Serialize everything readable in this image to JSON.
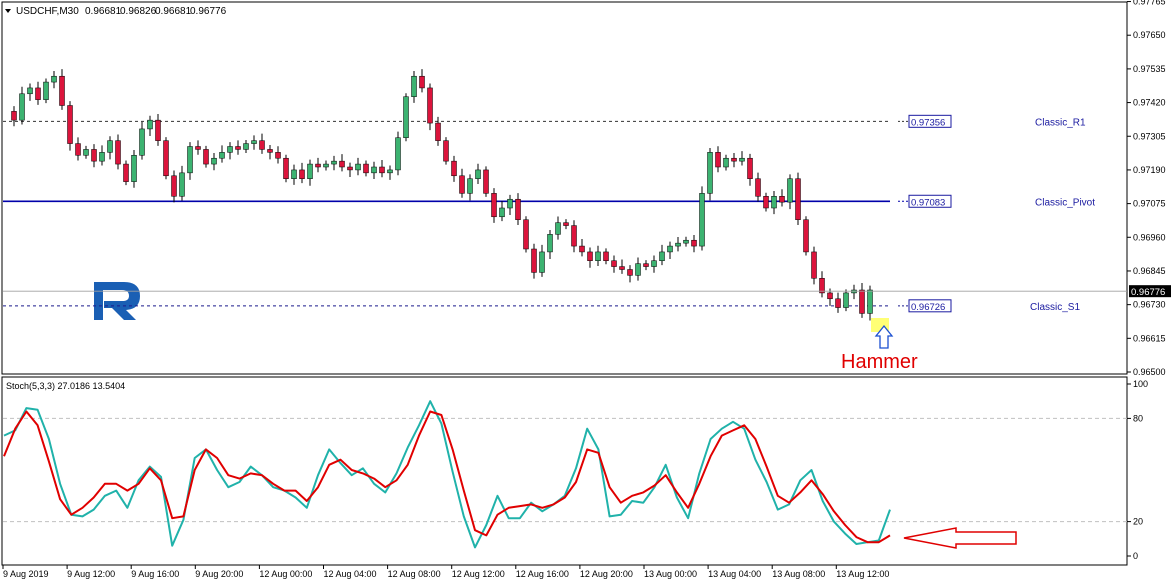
{
  "chart_data": [
    {
      "type": "candlestick",
      "symbol_header": "USDCHF,M30",
      "ohlc_header": [
        "0.96681",
        "0.96826",
        "0.96681",
        "0.96776"
      ],
      "current_price_label": "0.96776",
      "ylim": [
        0.965,
        0.9776
      ],
      "y_ticks": [
        "0.97765",
        "0.97650",
        "0.97535",
        "0.97420",
        "0.97305",
        "0.97190",
        "0.97075",
        "0.96960",
        "0.96845",
        "0.96730",
        "0.96615",
        "0.96500"
      ],
      "levels": [
        {
          "name": "Classic_R1",
          "value_label": "0.97356",
          "value": 0.97356,
          "style": "dashed",
          "color": "#333333"
        },
        {
          "name": "Classic_Pivot",
          "value_label": "0.97083",
          "value": 0.97083,
          "style": "solid",
          "color": "#0000aa"
        },
        {
          "name": "Classic_S1",
          "value_label": "0.96726",
          "value": 0.96726,
          "style": "dashed",
          "color": "#1a1a8c"
        }
      ],
      "current_price": 0.96776,
      "candles_close_path": [
        0.9739,
        0.9736,
        0.9745,
        0.9747,
        0.9743,
        0.9749,
        0.9751,
        0.9741,
        0.9728,
        0.9724,
        0.9726,
        0.9722,
        0.9725,
        0.9729,
        0.9721,
        0.9715,
        0.9724,
        0.9733,
        0.9736,
        0.9729,
        0.9717,
        0.971,
        0.9718,
        0.9727,
        0.9726,
        0.9721,
        0.9723,
        0.9725,
        0.9727,
        0.9726,
        0.9728,
        0.9729,
        0.9726,
        0.9725,
        0.9723,
        0.9716,
        0.9719,
        0.9716,
        0.9721,
        0.972,
        0.9721,
        0.9722,
        0.972,
        0.9719,
        0.9721,
        0.9718,
        0.972,
        0.9718,
        0.9719,
        0.973,
        0.9744,
        0.9751,
        0.9747,
        0.9735,
        0.9729,
        0.9722,
        0.9717,
        0.9711,
        0.9716,
        0.9719,
        0.9711,
        0.9703,
        0.9706,
        0.9709,
        0.9702,
        0.9692,
        0.9684,
        0.9691,
        0.9697,
        0.9701,
        0.97,
        0.9693,
        0.9691,
        0.9688,
        0.9691,
        0.9688,
        0.9686,
        0.9685,
        0.9683,
        0.9687,
        0.9686,
        0.9688,
        0.9691,
        0.9693,
        0.9694,
        0.9695,
        0.9693,
        0.9711,
        0.9725,
        0.972,
        0.9723,
        0.9722,
        0.9723,
        0.9716,
        0.971,
        0.9706,
        0.971,
        0.9708,
        0.9716,
        0.9702,
        0.9691,
        0.9682,
        0.9677,
        0.9675,
        0.9672,
        0.9677,
        0.9678,
        0.967,
        0.9678
      ]
    },
    {
      "type": "line",
      "indicator_header": "Stoch(5,3,3) 27.0186 13.5404",
      "ylim": [
        0,
        100
      ],
      "y_ticks": [
        "100",
        "80",
        "20",
        "0"
      ],
      "level_lines": [
        80,
        20
      ],
      "series": [
        {
          "color": "#20b2aa",
          "values": [
            70,
            73,
            86,
            85,
            68,
            42,
            24,
            23,
            27,
            35,
            38,
            28,
            44,
            52,
            46,
            6,
            21,
            57,
            62,
            50,
            40,
            43,
            52,
            47,
            40,
            38,
            34,
            28,
            47,
            62,
            54,
            47,
            51,
            42,
            37,
            48,
            63,
            76,
            90,
            77,
            49,
            23,
            5,
            18,
            35,
            22,
            22,
            31,
            26,
            30,
            35,
            51,
            74,
            62,
            23,
            24,
            32,
            31,
            40,
            53,
            34,
            22,
            48,
            68,
            74,
            78,
            74,
            56,
            43,
            27,
            30,
            44,
            50,
            32,
            20,
            13,
            7,
            8,
            9,
            27
          ]
        },
        {
          "color": "#e00000",
          "values": [
            58,
            74,
            84,
            76,
            55,
            33,
            24,
            28,
            34,
            42,
            42,
            38,
            42,
            51,
            44,
            22,
            23,
            50,
            62,
            57,
            47,
            45,
            48,
            47,
            42,
            38,
            38,
            32,
            40,
            53,
            56,
            50,
            48,
            45,
            40,
            44,
            53,
            70,
            84,
            82,
            62,
            38,
            15,
            12,
            24,
            28,
            29,
            30,
            28,
            30,
            34,
            43,
            62,
            60,
            40,
            31,
            35,
            37,
            41,
            47,
            37,
            28,
            42,
            58,
            70,
            73,
            76,
            68,
            52,
            35,
            31,
            37,
            44,
            36,
            26,
            18,
            11,
            8,
            8,
            12
          ]
        }
      ]
    }
  ],
  "x_axis_labels": [
    "9 Aug 2019",
    "9 Aug 12:00",
    "9 Aug 16:00",
    "9 Aug 20:00",
    "12 Aug 00:00",
    "12 Aug 04:00",
    "12 Aug 08:00",
    "12 Aug 12:00",
    "12 Aug 16:00",
    "12 Aug 20:00",
    "13 Aug 00:00",
    "13 Aug 04:00",
    "13 Aug 08:00",
    "13 Aug 12:00"
  ],
  "annotations": {
    "hammer_label": "Hammer",
    "up_arrow_color": "#1a4fd1",
    "callout_arrow_color": "#e00000",
    "highlight_color": "#ffff66"
  },
  "colors": {
    "bull": "#3cb371",
    "bear": "#dc143c",
    "axis": "#000000",
    "grid_dash": "#c0c0c0",
    "current_price_bg": "#000000"
  },
  "logo": {
    "icon": "roboforex-logo-icon",
    "color": "#1a5fb4"
  }
}
